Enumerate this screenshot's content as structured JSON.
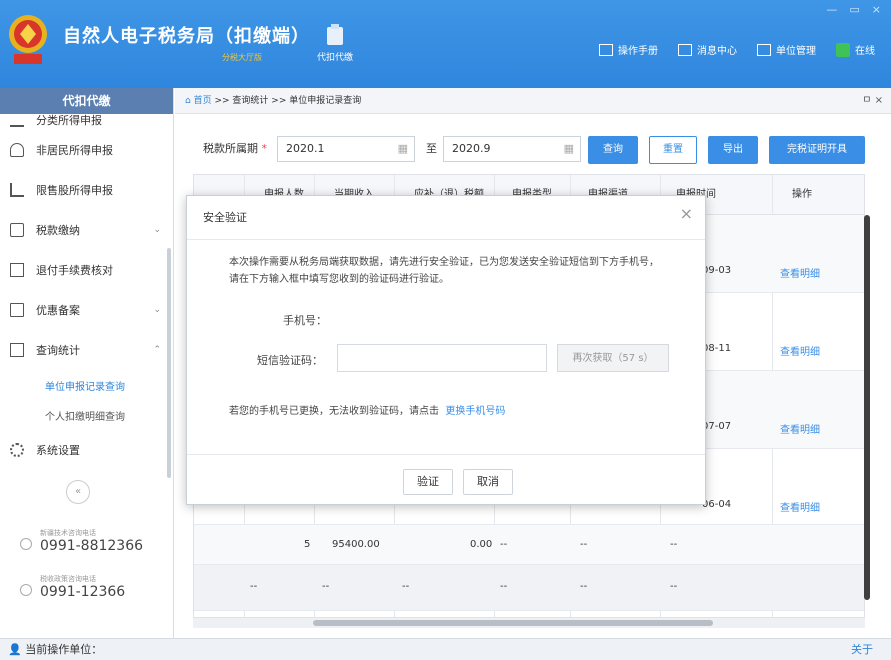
{
  "window": {
    "title": "自然人电子税务局（扣缴端）",
    "subtitle": "分税大厅版",
    "controls": [
      "—",
      "▭",
      "×"
    ]
  },
  "toolbar": {
    "main_button": "代扣代缴",
    "links": [
      {
        "label": "操作手册",
        "icon": "book-icon"
      },
      {
        "label": "消息中心",
        "icon": "mail-icon"
      },
      {
        "label": "单位管理",
        "icon": "building-icon"
      },
      {
        "label": "在线",
        "icon": "online-check-icon"
      }
    ]
  },
  "sidebar": {
    "header": "代扣代缴",
    "items": [
      {
        "label": "分类所得申报",
        "icon": "list-icon",
        "expandable": false
      },
      {
        "label": "非居民所得申报",
        "icon": "person-icon",
        "expandable": false
      },
      {
        "label": "限售股所得申报",
        "icon": "bar-chart-icon",
        "expandable": false
      },
      {
        "label": "税款缴纳",
        "icon": "card-icon",
        "expandable": true
      },
      {
        "label": "退付手续费核对",
        "icon": "receipt-icon",
        "expandable": false
      },
      {
        "label": "优惠备案",
        "icon": "document-icon",
        "expandable": true
      },
      {
        "label": "查询统计",
        "icon": "search-doc-icon",
        "expandable": true,
        "expanded": true
      }
    ],
    "sub_items": [
      {
        "label": "单位申报记录查询",
        "active": true
      },
      {
        "label": "个人扣缴明细查询",
        "active": false
      }
    ],
    "settings": {
      "label": "系统设置",
      "icon": "gear-icon"
    },
    "hotlines": [
      {
        "caption": "新疆技术咨询电话",
        "number": "0991-8812366"
      },
      {
        "caption": "税收政策咨询电话",
        "number": "0991-12366"
      }
    ]
  },
  "breadcrumb": {
    "home": "首页",
    "sep1": " >> ",
    "level1": "查询统计",
    "sep2": " >> ",
    "level2": "单位申报记录查询",
    "controls": "ㅁ ×"
  },
  "filter": {
    "label": "税款所属期",
    "required": "*",
    "start": "2020.1",
    "to": "至",
    "end": "2020.9",
    "buttons": {
      "query": "查询",
      "reset": "重置",
      "export": "导出",
      "cert": "完税证明开具"
    }
  },
  "table": {
    "headers": [
      "",
      "申报人数",
      "当期收入",
      "应补（退）税额",
      "申报类型",
      "申报渠道",
      "申报时间",
      "操作"
    ],
    "rows": [
      {
        "date": "09-03",
        "action": "查看明细"
      },
      {
        "date": "08-11",
        "action": "查看明细"
      },
      {
        "date": "07-07",
        "action": "查看明细"
      },
      {
        "date": "06-04",
        "action": "查看明细"
      },
      {
        "count": "5",
        "income": "95400.00",
        "tax": "0.00",
        "type": "--",
        "channel": "--",
        "time": "--"
      },
      {
        "count": "--",
        "income": "--",
        "tax": "--",
        "type": "--",
        "channel": "--",
        "time": "--"
      }
    ]
  },
  "modal": {
    "title": "安全验证",
    "message": "本次操作需要从税务局端获取数据，请先进行安全验证，已为您发送安全验证短信到下方手机号，请在下方输入框中填写您收到的验证码进行验证。",
    "phone_label": "手机号：",
    "phone_value": "",
    "code_label": "短信验证码：",
    "code_placeholder": "",
    "resend": "再次获取（57 s）",
    "change_text": "若您的手机号已更换，无法收到验证码，请点击",
    "change_link": "更换手机号码",
    "verify": "验证",
    "cancel": "取消"
  },
  "status": {
    "current_unit_label": "当前操作单位：",
    "about": "关于"
  },
  "colors": {
    "brand_blue": "#2f86dd",
    "button_blue": "#3a8ee6",
    "sidebar_header": "#5b7fb0",
    "online_green": "#3fc256"
  }
}
